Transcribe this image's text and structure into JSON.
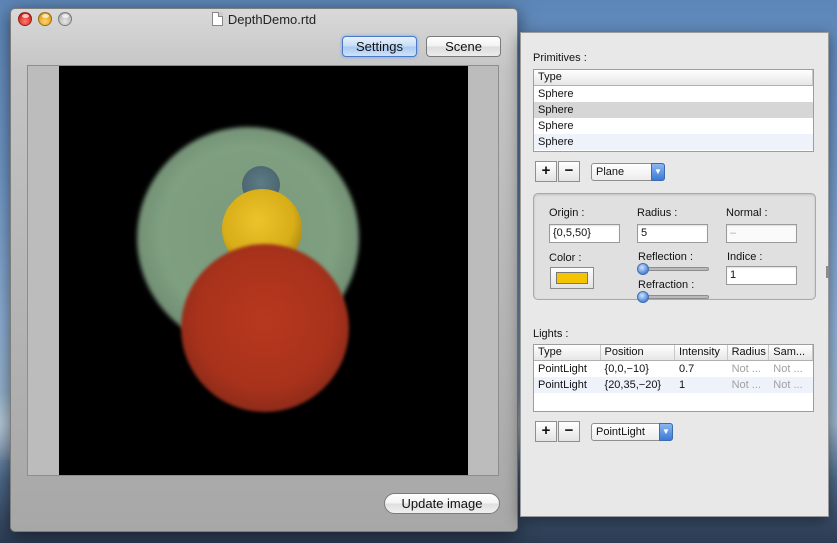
{
  "window": {
    "title": "DepthDemo.rtd",
    "buttons": {
      "settings": "Settings",
      "scene": "Scene",
      "update_image": "Update image"
    }
  },
  "primitives": {
    "label": "Primitives :",
    "column": "Type",
    "rows": [
      "Sphere",
      "Sphere",
      "Sphere",
      "Sphere"
    ],
    "add_label": "+",
    "remove_label": "−",
    "type_popup": "Plane"
  },
  "primitive_editor": {
    "origin_label": "Origin :",
    "origin_value": "{0,5,50}",
    "radius_label": "Radius :",
    "radius_value": "5",
    "normal_label": "Normal :",
    "normal_value": "–",
    "color_label": "Color :",
    "color_value": "#f5c400",
    "reflection_label": "Reflection :",
    "reflection_level": 0,
    "refraction_label": "Refraction :",
    "refraction_level": 0,
    "indice_label": "Indice :",
    "indice_value": "1"
  },
  "lights": {
    "label": "Lights :",
    "columns": [
      "Type",
      "Position",
      "Intensity",
      "Radius",
      "Sam..."
    ],
    "rows": [
      {
        "type": "PointLight",
        "position": "{0,0,−10}",
        "intensity": "0.7",
        "radius": "Not ...",
        "samples": "Not ..."
      },
      {
        "type": "PointLight",
        "position": "{20,35,−20}",
        "intensity": "1",
        "radius": "Not ...",
        "samples": "Not ..."
      }
    ],
    "add_label": "+",
    "remove_label": "−",
    "type_popup": "PointLight"
  }
}
